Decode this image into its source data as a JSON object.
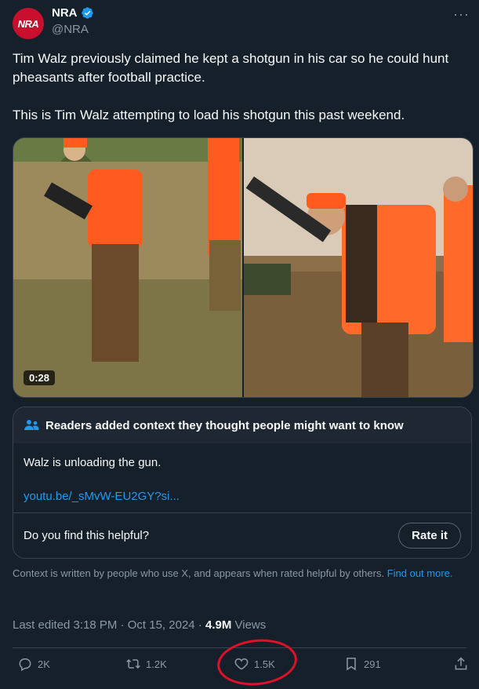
{
  "author": {
    "avatar_text": "NRA",
    "display_name": "NRA",
    "handle": "@NRA"
  },
  "tweet": {
    "text": "Tim Walz previously claimed he kept a shotgun in his car so he could hunt pheasants after football practice.\n\nThis is Tim Walz attempting to load his shotgun this past weekend."
  },
  "media": {
    "duration": "0:28"
  },
  "community_note": {
    "header": "Readers added context they thought people might want to know",
    "text": "Walz is unloading the gun.",
    "link": "youtu.be/_sMvW-EU2GY?si...",
    "question": "Do you find this helpful?",
    "rate_label": "Rate it"
  },
  "context": {
    "text": "Context is written by people who use X, and appears when rated helpful by others.",
    "link": "Find out more."
  },
  "meta": {
    "edited": "Last edited 3:18 PM · Oct 15, 2024 · ",
    "views_count": "4.9M",
    "views_label": " Views"
  },
  "actions": {
    "replies": "2K",
    "reposts": "1.2K",
    "likes": "1.5K",
    "bookmarks": "291"
  },
  "icons": {
    "verified": "verified-badge-icon",
    "more": "more-options-icon",
    "people": "people-icon",
    "reply": "reply-icon",
    "repost": "repost-icon",
    "like": "heart-icon",
    "bookmark": "bookmark-icon",
    "share": "share-icon"
  },
  "colors": {
    "background": "#15202b",
    "accent": "#1d9bf0",
    "muted": "#8b98a5",
    "annotation_circle": "#e0102a"
  }
}
